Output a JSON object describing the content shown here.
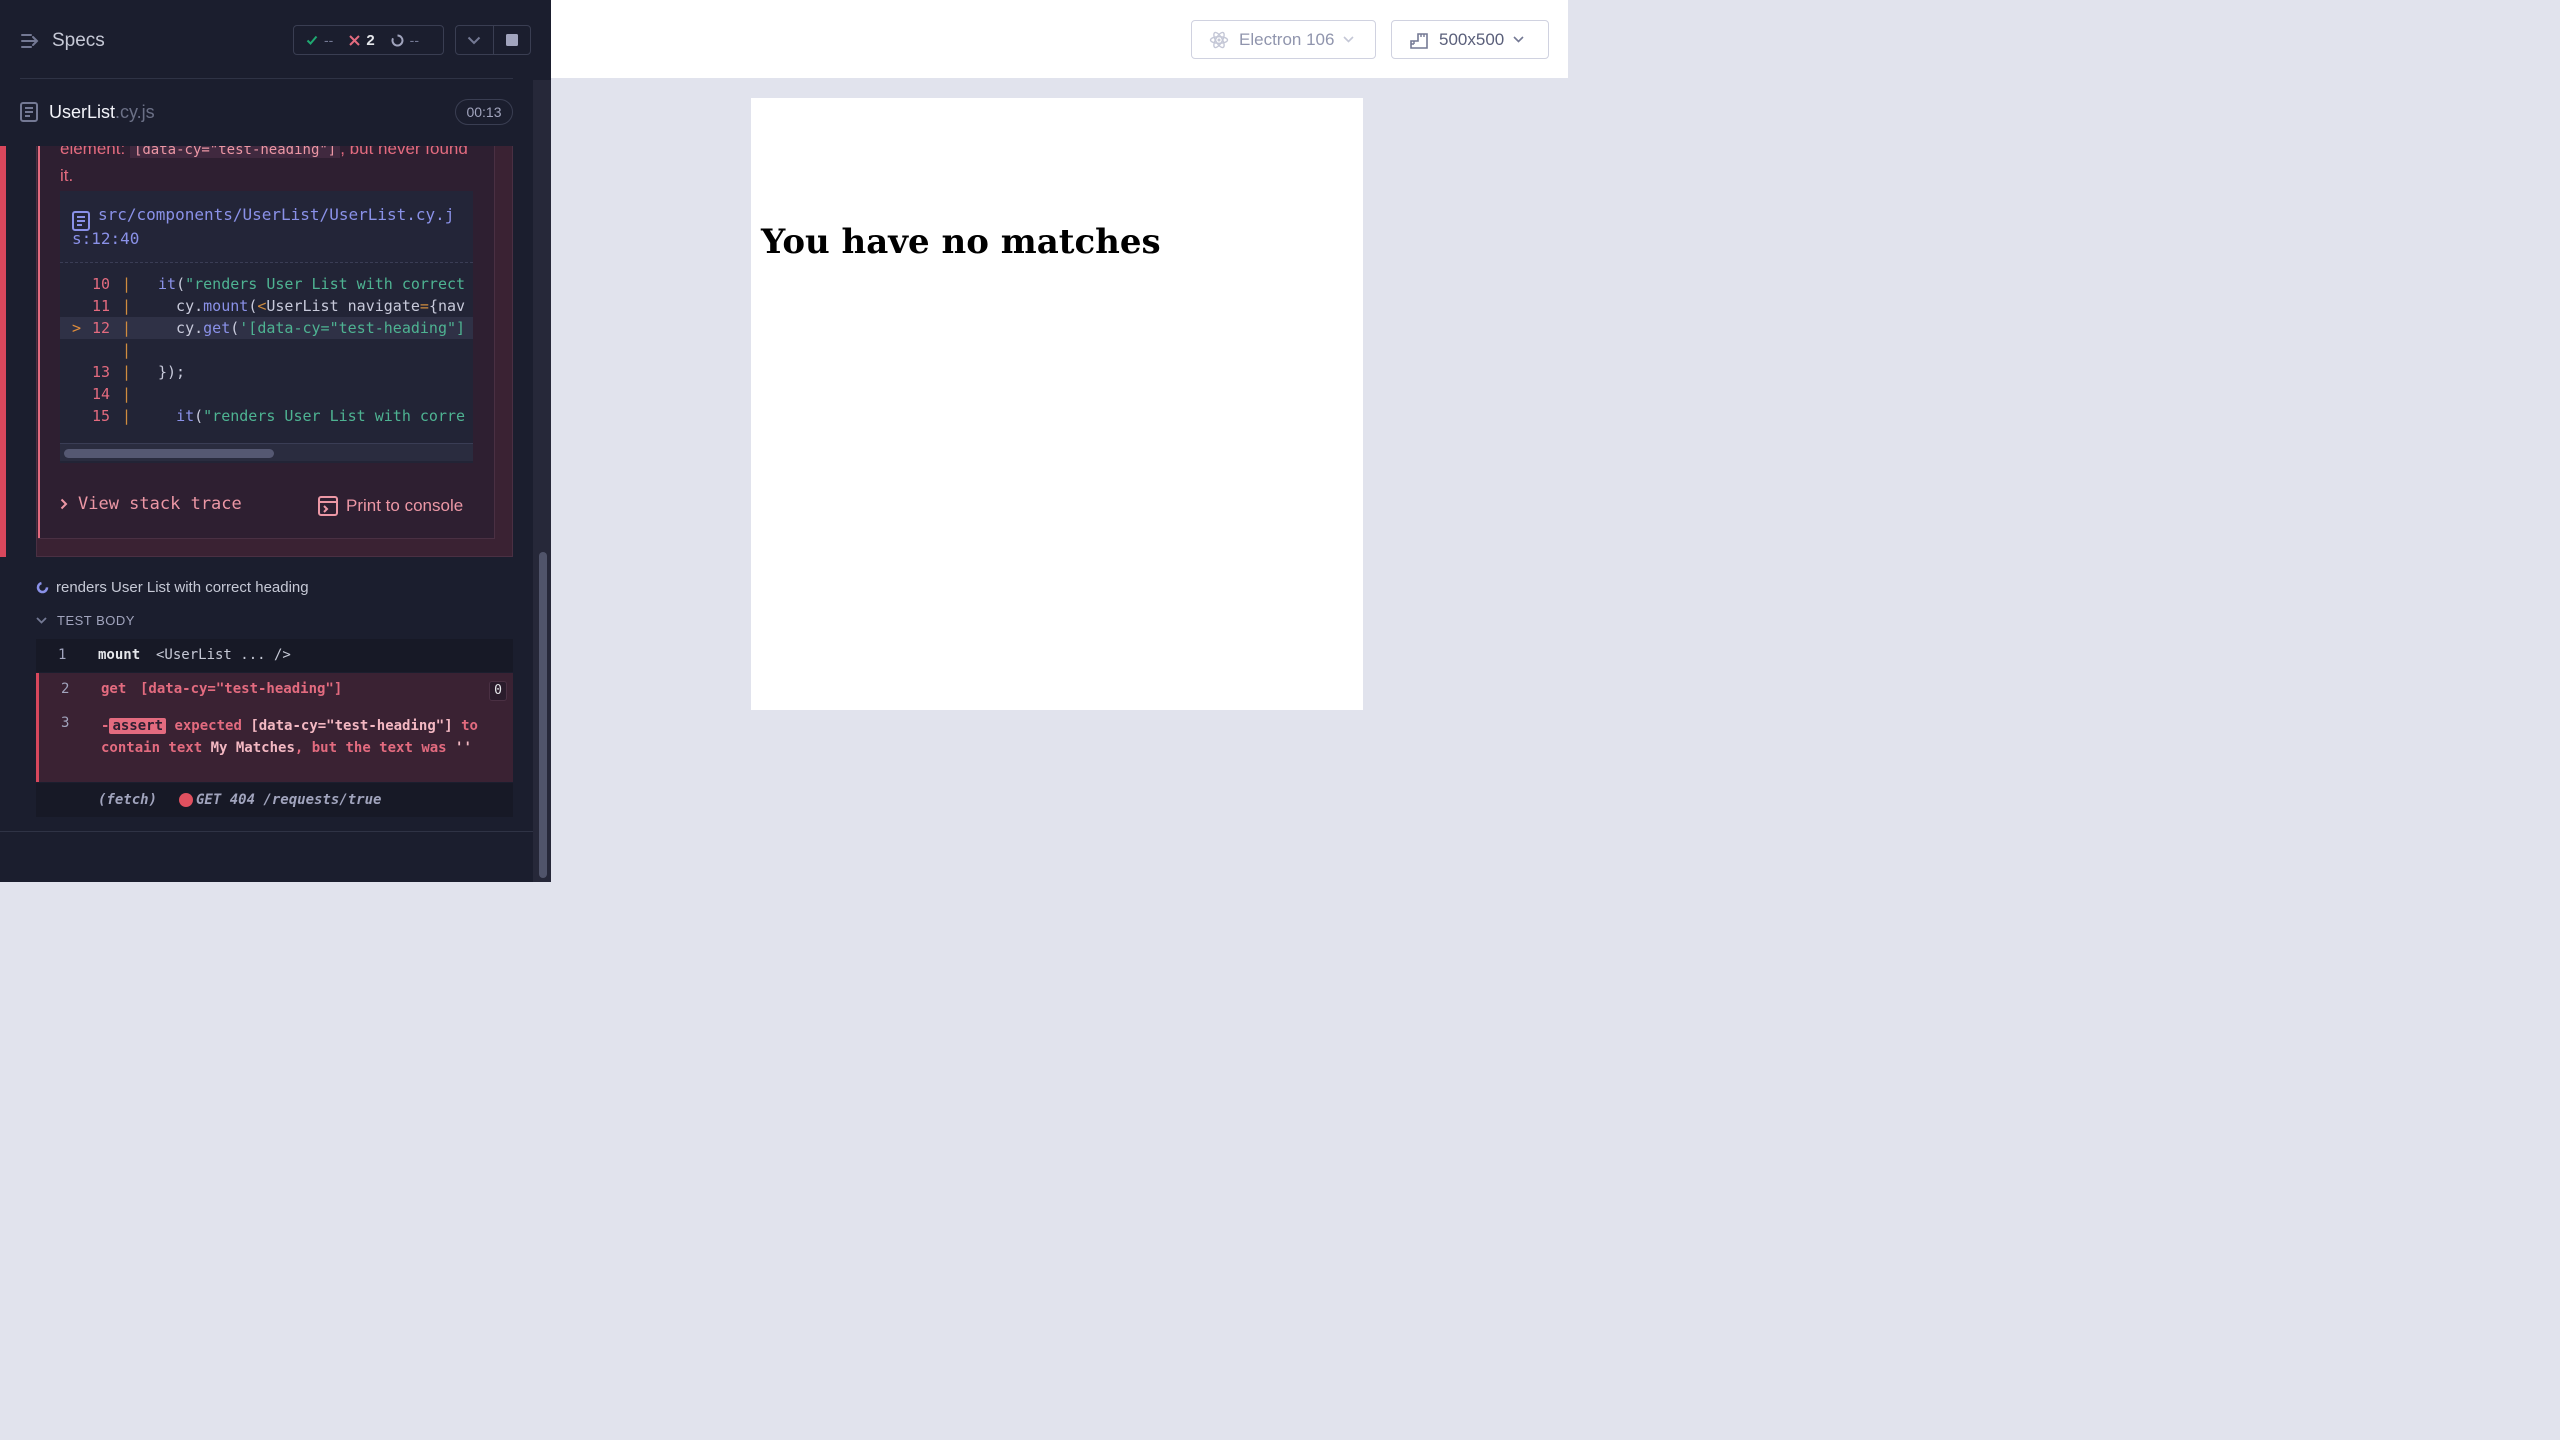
{
  "reporter": {
    "specs_label": "Specs",
    "stats": {
      "passed": "--",
      "failed": "2",
      "pending": "--"
    },
    "spec": {
      "name": "UserList",
      "ext": ".cy.js",
      "duration": "00:13"
    },
    "error": {
      "message_prefix": "element: ",
      "message_code": "[data-cy=\"test-heading\"]",
      "message_suffix": ", but never found it.",
      "file_path": "src/components/UserList/UserList.cy.js:12:40",
      "code_lines": [
        {
          "num": "10",
          "text": "it(\"renders User List with correct"
        },
        {
          "num": "11",
          "text": "  cy.mount(<UserList navigate={nav"
        },
        {
          "num": "12",
          "text": "  cy.get('[data-cy=\"test-heading\"]"
        },
        {
          "num": "",
          "text": ""
        },
        {
          "num": "13",
          "text": "});"
        },
        {
          "num": "14",
          "text": ""
        },
        {
          "num": "15",
          "text": "  it(\"renders User List with corre"
        }
      ],
      "stack_trace_label": "View stack trace",
      "print_console_label": "Print to console"
    },
    "test_title": "renders User List with correct heading",
    "test_body_label": "TEST BODY",
    "commands": {
      "c1": {
        "num": "1",
        "name": "mount",
        "msg": "<UserList ... />"
      },
      "c2": {
        "num": "2",
        "name": "get",
        "msg": "[data-cy=\"test-heading\"]",
        "count": "0"
      },
      "c3": {
        "num": "3",
        "badge": "assert",
        "expected": "expected",
        "selector": "[data-cy=\"test-heading\"]",
        "contain": "to contain text",
        "text": "My Matches",
        "tail": ", but the text was",
        "value": "''"
      },
      "fetch": {
        "label": "(fetch)",
        "request": "GET 404 /requests/true"
      }
    }
  },
  "aut": {
    "browser_label": "Electron 106",
    "viewport_label": "500x500",
    "heading": "You have no matches"
  },
  "colors": {
    "accent_fail": "#e36b7f",
    "accent_pass": "#1fa971",
    "reporter_bg": "#1b1e2e",
    "aut_bg": "#e1e3ed"
  }
}
